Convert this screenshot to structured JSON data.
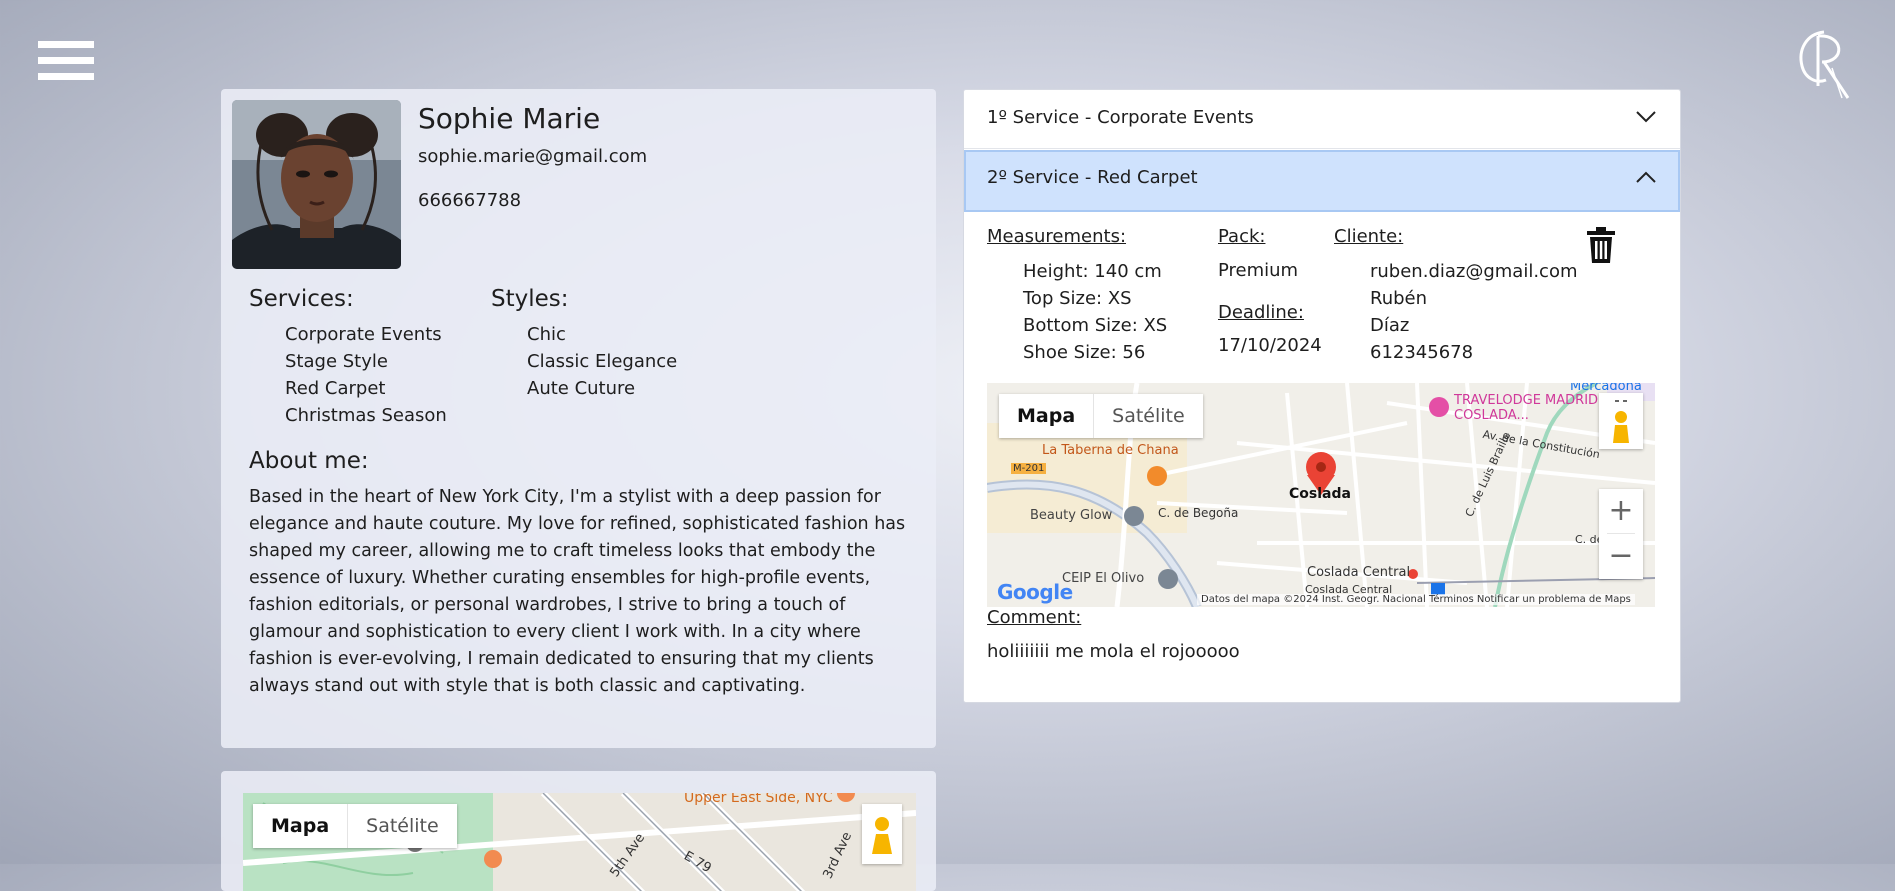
{
  "profile": {
    "name": "Sophie Marie",
    "email": "sophie.marie@gmail.com",
    "phone": "666667788",
    "services_heading": "Services:",
    "services": [
      "Corporate Events",
      "Stage Style",
      "Red Carpet",
      "Christmas Season"
    ],
    "styles_heading": "Styles:",
    "styles": [
      "Chic",
      "Classic Elegance",
      "Aute Cuture"
    ],
    "about_heading": "About me:",
    "about_text": "Based in the heart of New York City, I'm a stylist with a deep passion for elegance and haute couture. My love for refined, sophisticated fashion has shaped my career, allowing me to craft timeless looks that embody the essence of luxury. Whether curating ensembles for high-profile events, fashion editorials, or personal wardrobes, I strive to bring a touch of glamour and sophistication to every client I work with. In a city where fashion is ever-evolving, I remain dedicated to ensuring that my clients always stand out with style that is both classic and captivating."
  },
  "accordion": [
    {
      "label": "1º Service - Corporate Events",
      "expanded": false
    },
    {
      "label": "2º Service - Red Carpet",
      "expanded": true
    }
  ],
  "service_detail": {
    "measurements_label": "Measurements:",
    "measurements": [
      "Height: 140 cm",
      "Top Size: XS",
      "Bottom Size: XS",
      "Shoe Size: 56"
    ],
    "pack_label": "Pack:",
    "pack": "Premium",
    "deadline_label": "Deadline:",
    "deadline": "17/10/2024",
    "client_label": "Cliente:",
    "client": [
      "ruben.diaz@gmail.com",
      "Rubén",
      "Díaz",
      "612345678"
    ],
    "comment_label": "Comment:",
    "comment": "holiiiiiii me mola el rojooooo"
  },
  "map_service": {
    "type_map": "Mapa",
    "type_satellite": "Satélite",
    "zoom_in": "+",
    "zoom_out": "−",
    "labels": {
      "mercadona": "Mercadona",
      "travelodge": "TRAVELODGE MADRID COSLADA...",
      "taberna": "La Taberna de Chana",
      "m201": "M-201",
      "beauty": "Beauty Glow",
      "begona": "C. de Begoña",
      "coslada": "Coslada",
      "constitucion": "Av. de la Constitución",
      "braille": "C. de Luis Braille",
      "ceip": "CEIP El Olivo",
      "coslada_central": "Coslada Central",
      "coslada_central2": "Coslada Central",
      "cde": "C. de"
    },
    "google": "Google",
    "footer": "Datos del mapa ©2024 Inst. Geogr. Nacional   Términos   Notificar un problema de Maps"
  },
  "map_profile": {
    "type_map": "Mapa",
    "type_satellite": "Satélite",
    "labels": {
      "ues": "Upper East Side, NYC",
      "fifth": "5th Ave",
      "third": "3rd Ave",
      "e79": "E 79"
    }
  },
  "colors": {
    "accent_header": "#cfe2fd",
    "marker": "#ea4335"
  }
}
